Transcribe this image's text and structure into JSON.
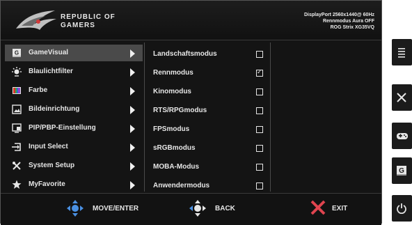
{
  "header": {
    "brand_line1": "REPUBLIC OF",
    "brand_line2": "GAMERS",
    "info_line1": "DisplayPort 2560x1440@ 60Hz",
    "info_line2": "Rennmodus Aura OFF",
    "info_line3": "ROG Strix XG35VQ"
  },
  "main_menu": {
    "items": [
      {
        "label": "GameVisual",
        "icon": "gamevisual-icon",
        "selected": true
      },
      {
        "label": "Blaulichtfilter",
        "icon": "blue-light-icon"
      },
      {
        "label": "Farbe",
        "icon": "color-icon"
      },
      {
        "label": "Bildeinrichtung",
        "icon": "image-icon"
      },
      {
        "label": "PIP/PBP-Einstellung",
        "icon": "pip-icon"
      },
      {
        "label": "Input Select",
        "icon": "input-icon"
      },
      {
        "label": "System Setup",
        "icon": "tools-icon"
      },
      {
        "label": "MyFavorite",
        "icon": "star-icon"
      }
    ]
  },
  "sub_menu": {
    "items": [
      {
        "label": "Landschaftsmodus",
        "checked": false
      },
      {
        "label": "Rennmodus",
        "checked": true
      },
      {
        "label": "Kinomodus",
        "checked": false
      },
      {
        "label": "RTS/RPGmodus",
        "checked": false
      },
      {
        "label": "FPSmodus",
        "checked": false
      },
      {
        "label": "sRGBmodus",
        "checked": false
      },
      {
        "label": "MOBA-Modus",
        "checked": false
      },
      {
        "label": "Anwendermodus",
        "checked": false
      }
    ]
  },
  "footer": {
    "move_enter": "MOVE/ENTER",
    "back": "BACK",
    "exit": "EXIT",
    "joystick_color": "#4a90e2",
    "exit_color": "#e0444f"
  },
  "hotkeys": [
    {
      "icon": "menu-icon"
    },
    {
      "icon": "close-icon"
    },
    {
      "icon": "gamepad-icon"
    },
    {
      "icon": "gamevisual-icon"
    },
    {
      "icon": "power-icon"
    }
  ]
}
